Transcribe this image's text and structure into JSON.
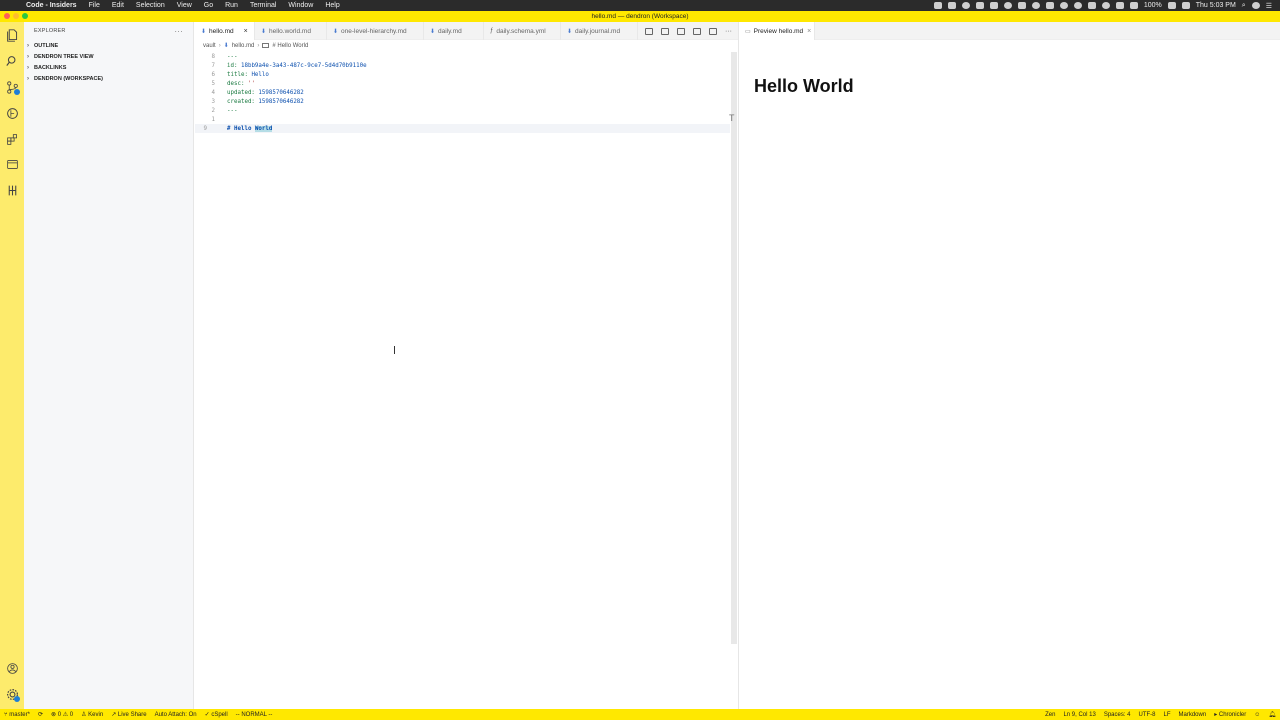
{
  "menubar": {
    "app_name": "Code - Insiders",
    "items": [
      "File",
      "Edit",
      "Selection",
      "View",
      "Go",
      "Run",
      "Terminal",
      "Window",
      "Help"
    ],
    "battery": "100%",
    "clock": "Thu 5:03 PM"
  },
  "window": {
    "title": "hello.md — dendron (Workspace)"
  },
  "sidebar": {
    "title": "EXPLORER",
    "more": "···",
    "sections": [
      {
        "label": "OUTLINE"
      },
      {
        "label": "DENDRON TREE VIEW"
      },
      {
        "label": "BACKLINKS"
      },
      {
        "label": "DENDRON (WORKSPACE)"
      }
    ]
  },
  "editor": {
    "tabs": [
      {
        "label": "hello.md",
        "icon": "markdown-icon",
        "active": true
      },
      {
        "label": "hello.world.md",
        "icon": "markdown-icon"
      },
      {
        "label": "one-level-hierarchy.md",
        "icon": "markdown-icon"
      },
      {
        "label": "daily.md",
        "icon": "markdown-icon"
      },
      {
        "label": "daily.schema.yml",
        "icon": "yaml-icon"
      },
      {
        "label": "daily.journal.md",
        "icon": "markdown-icon"
      }
    ],
    "close_glyph": "×",
    "breadcrumb": [
      "vault",
      "hello.md",
      "# Hello World"
    ],
    "lines": [
      {
        "num": "8",
        "key": "---",
        "val": ""
      },
      {
        "num": "7",
        "key": "id: ",
        "val": "18bb9a4e-3a43-487c-9ce7-5d4d70b9110e"
      },
      {
        "num": "6",
        "key": "title: ",
        "val": "Hello"
      },
      {
        "num": "5",
        "key": "desc: ",
        "val": "''"
      },
      {
        "num": "4",
        "key": "updated: ",
        "val": "1598570646282"
      },
      {
        "num": "3",
        "key": "created: ",
        "val": "1598570646282"
      },
      {
        "num": "2",
        "key": "---",
        "val": ""
      },
      {
        "num": "1",
        "key": "",
        "val": ""
      },
      {
        "num": "9",
        "heading_prefix": "# Hello ",
        "heading_selected": "World"
      }
    ]
  },
  "preview": {
    "tab_label": "Preview hello.md",
    "heading": "Hello World"
  },
  "statusbar": {
    "branch": "master*",
    "problems": "0",
    "warnings": "0",
    "user": "Kevin",
    "live_share": "Live Share",
    "auto_attach": "Auto Attach: On",
    "spell": "cSpell",
    "mode": "-- NORMAL --",
    "zen": "Zen",
    "position": "Ln 9, Col 13",
    "spaces": "Spaces: 4",
    "encoding": "UTF-8",
    "eol": "LF",
    "language": "Markdown",
    "chronicler": "Chronicler"
  }
}
